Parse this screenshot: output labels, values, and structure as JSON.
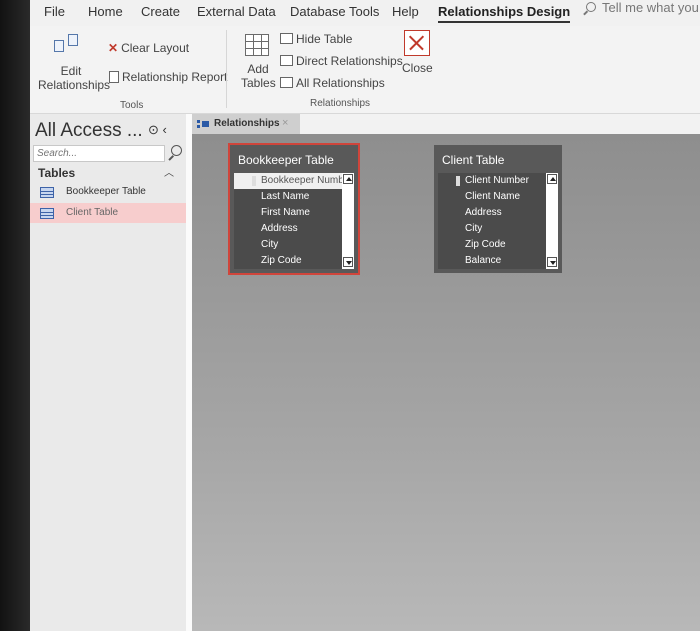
{
  "menu": {
    "tabs": [
      "File",
      "Home",
      "Create",
      "External Data",
      "Database Tools",
      "Help",
      "Relationships Design"
    ],
    "tell_me": "Tell me what you"
  },
  "ribbon": {
    "tools": {
      "edit_relationships": "Edit Relationships",
      "clear_layout": "Clear Layout",
      "relationship_report": "Relationship Report",
      "label": "Tools"
    },
    "relationships": {
      "add_tables": "Add Tables",
      "hide_table": "Hide Table",
      "direct_relationships": "Direct Relationships",
      "all_relationships": "All Relationships",
      "close": "Close",
      "label": "Relationships"
    }
  },
  "nav": {
    "title": "All Access ...",
    "search_placeholder": "Search...",
    "section": "Tables",
    "items": [
      {
        "label": "Bookkeeper Table"
      },
      {
        "label": "Client Table"
      }
    ]
  },
  "document": {
    "tab_label": "Relationships",
    "tab_close": "×"
  },
  "tables": [
    {
      "title": "Bookkeeper Table",
      "fields": [
        "Bookkeeper Number",
        "Last Name",
        "First Name",
        "Address",
        "City",
        "Zip Code"
      ]
    },
    {
      "title": "Client Table",
      "fields": [
        "Client Number",
        "Client Name",
        "Address",
        "City",
        "Zip Code",
        "Balance"
      ]
    }
  ],
  "colors": {
    "selection_outline": "#d0453b",
    "selected_nav_item": "#f7cdcd"
  },
  "icons": [
    "edit-relationships-icon",
    "clear-layout-icon",
    "relationship-report-icon",
    "add-tables-icon",
    "hide-table-icon",
    "direct-relationships-icon",
    "all-relationships-icon",
    "close-icon",
    "search-icon",
    "table-icon",
    "key-icon"
  ]
}
